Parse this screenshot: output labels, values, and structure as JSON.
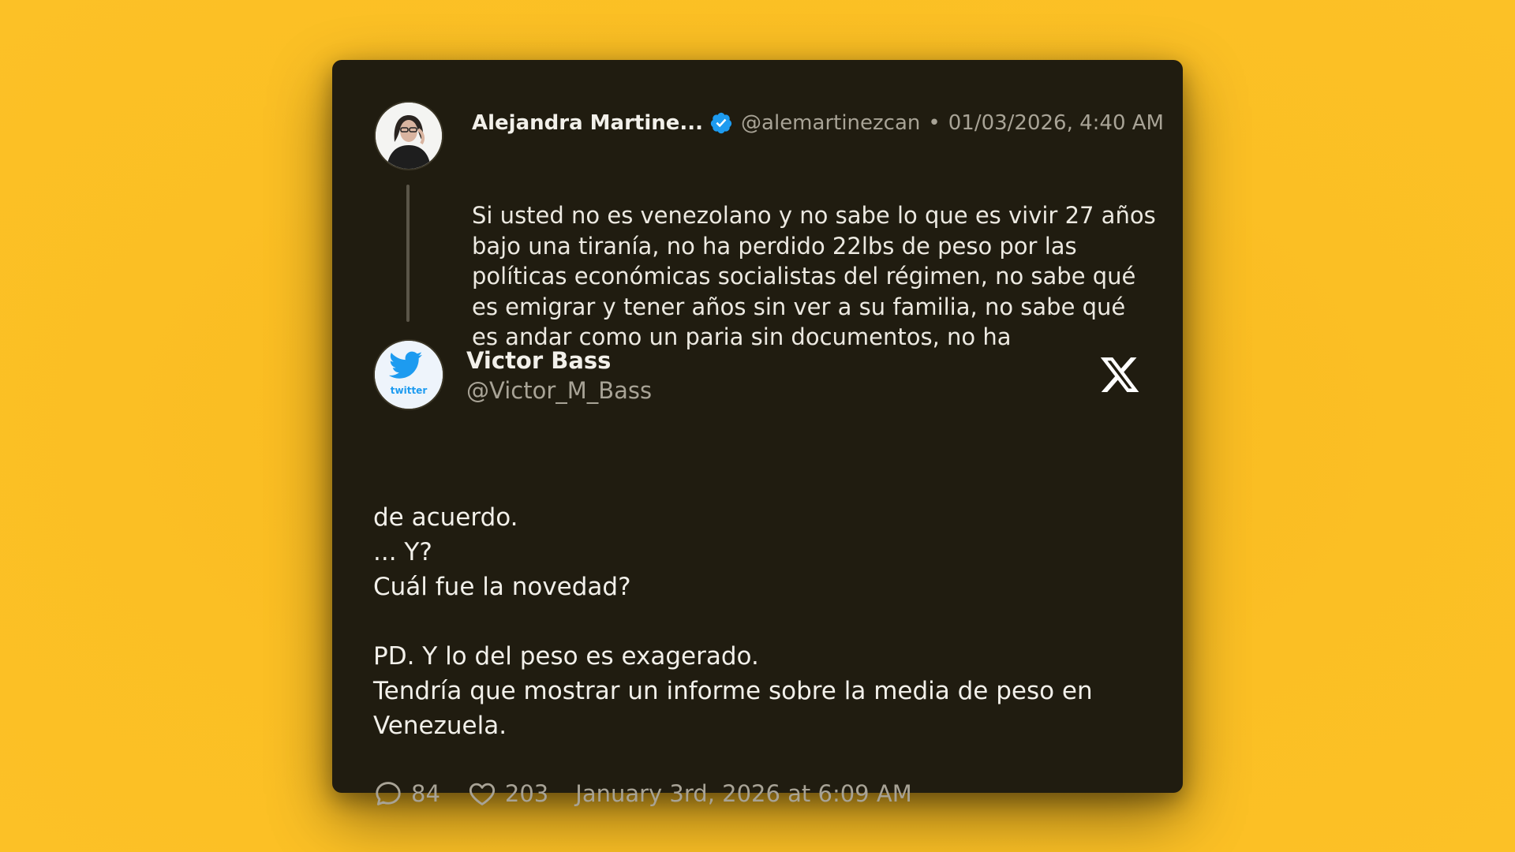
{
  "quoted_tweet": {
    "author_name": "Alejandra Martine...",
    "verified": true,
    "handle": "@alemartinezcan",
    "separator": "•",
    "timestamp": "01/03/2026, 4:40 AM",
    "text": "Si usted no es venezolano y no sabe lo que es vivir 27 años bajo una tiranía, no ha perdido 22lbs de peso por las políticas económicas socialistas del régimen, no sabe qué es emigrar y tener años sin ver a su familia, no sabe qué es andar como un paria sin documentos, no ha"
  },
  "author": {
    "name": "Victor Bass",
    "handle": "@Victor_M_Bass",
    "avatar_icon": "twitter-bird-icon",
    "avatar_text": "twitter"
  },
  "platform_icon": "x-logo-icon",
  "tweet": {
    "lines": [
      "de acuerdo.",
      "... Y?",
      "Cuál fue la novedad?",
      "",
      "PD. Y lo del peso es exagerado.",
      "Tendría que mostrar un informe sobre la media de peso en Venezuela."
    ]
  },
  "footer": {
    "replies": "84",
    "likes": "203",
    "timestamp": "January 3rd, 2026 at 6:09 AM"
  },
  "colors": {
    "background": "#fbbf24",
    "card": "#201c10",
    "text_primary": "#f2f0ea",
    "text_secondary": "#a8a396",
    "verified_blue": "#1d9bf0",
    "twitter_blue": "#1d9bf0"
  }
}
